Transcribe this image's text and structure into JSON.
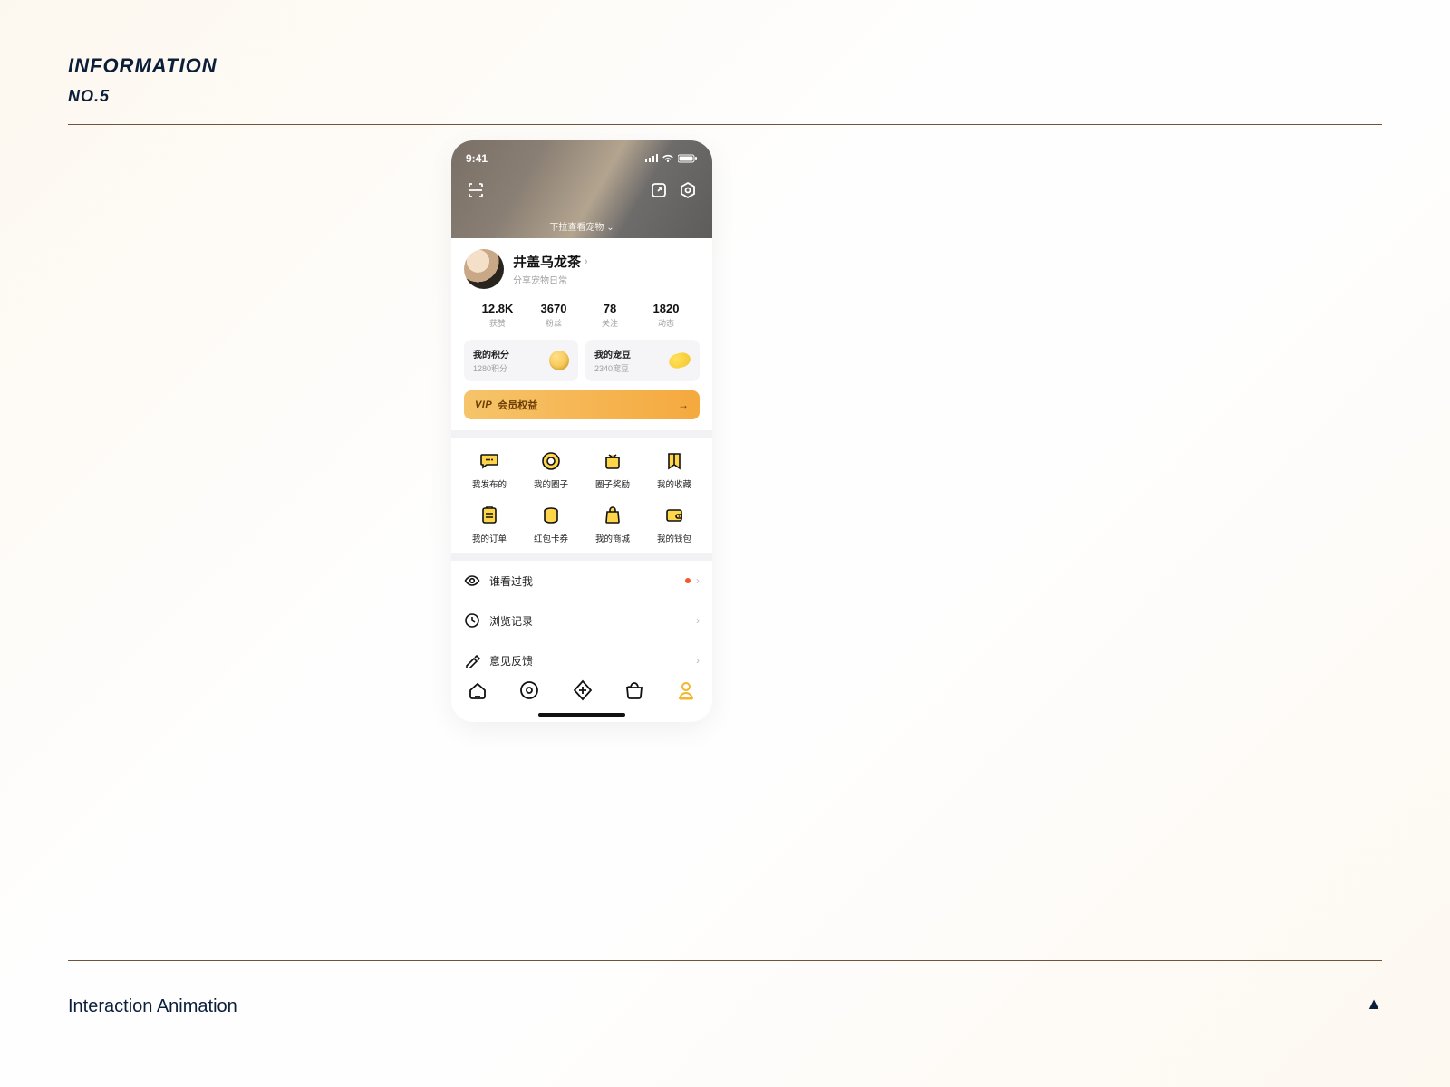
{
  "page": {
    "title": "INFORMATION",
    "subtitle": "NO.5",
    "footer": "Interaction Animation"
  },
  "statusbar": {
    "time": "9:41"
  },
  "hero": {
    "hint": "下拉查看宠物"
  },
  "profile": {
    "name": "井盖乌龙茶",
    "tagline": "分享宠物日常",
    "stats": [
      {
        "value": "12.8K",
        "label": "获赞"
      },
      {
        "value": "3670",
        "label": "粉丝"
      },
      {
        "value": "78",
        "label": "关注"
      },
      {
        "value": "1820",
        "label": "动态"
      }
    ],
    "points": {
      "title": "我的积分",
      "sub": "1280积分"
    },
    "beans": {
      "title": "我的宠豆",
      "sub": "2340宠豆"
    },
    "vip": {
      "prefix": "VIP",
      "label": "会员权益"
    }
  },
  "grid": [
    {
      "label": "我发布的"
    },
    {
      "label": "我的圈子"
    },
    {
      "label": "圈子奖励"
    },
    {
      "label": "我的收藏"
    },
    {
      "label": "我的订单"
    },
    {
      "label": "红包卡券"
    },
    {
      "label": "我的商城"
    },
    {
      "label": "我的钱包"
    }
  ],
  "list": [
    {
      "label": "谁看过我",
      "badge": true
    },
    {
      "label": "浏览记录",
      "badge": false
    },
    {
      "label": "意见反馈",
      "badge": false
    }
  ]
}
